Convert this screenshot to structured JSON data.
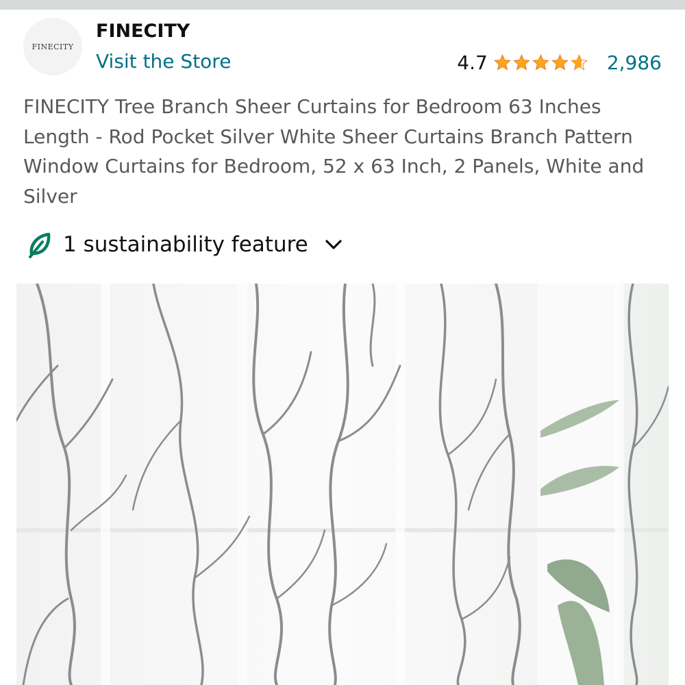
{
  "store": {
    "logo_text": "FINECITY",
    "brand_name": "FINECITY",
    "visit_link": "Visit the Store"
  },
  "rating": {
    "value": "4.7",
    "stars": 4.7,
    "count": "2,986",
    "star_color": "#ffa41c"
  },
  "product": {
    "title": "FINECITY Tree Branch Sheer Curtains for Bedroom 63 Inches Length - Rod Pocket Silver White Sheer Curtains Branch Pattern Window Curtains for Bedroom, 52 x 63 Inch, 2 Panels, White and Silver"
  },
  "sustainability": {
    "label": "1 sustainability feature",
    "icon": "leaf-icon",
    "accent": "#067d62"
  },
  "colors": {
    "link": "#007185",
    "text": "#0f1111",
    "muted": "#565959"
  }
}
